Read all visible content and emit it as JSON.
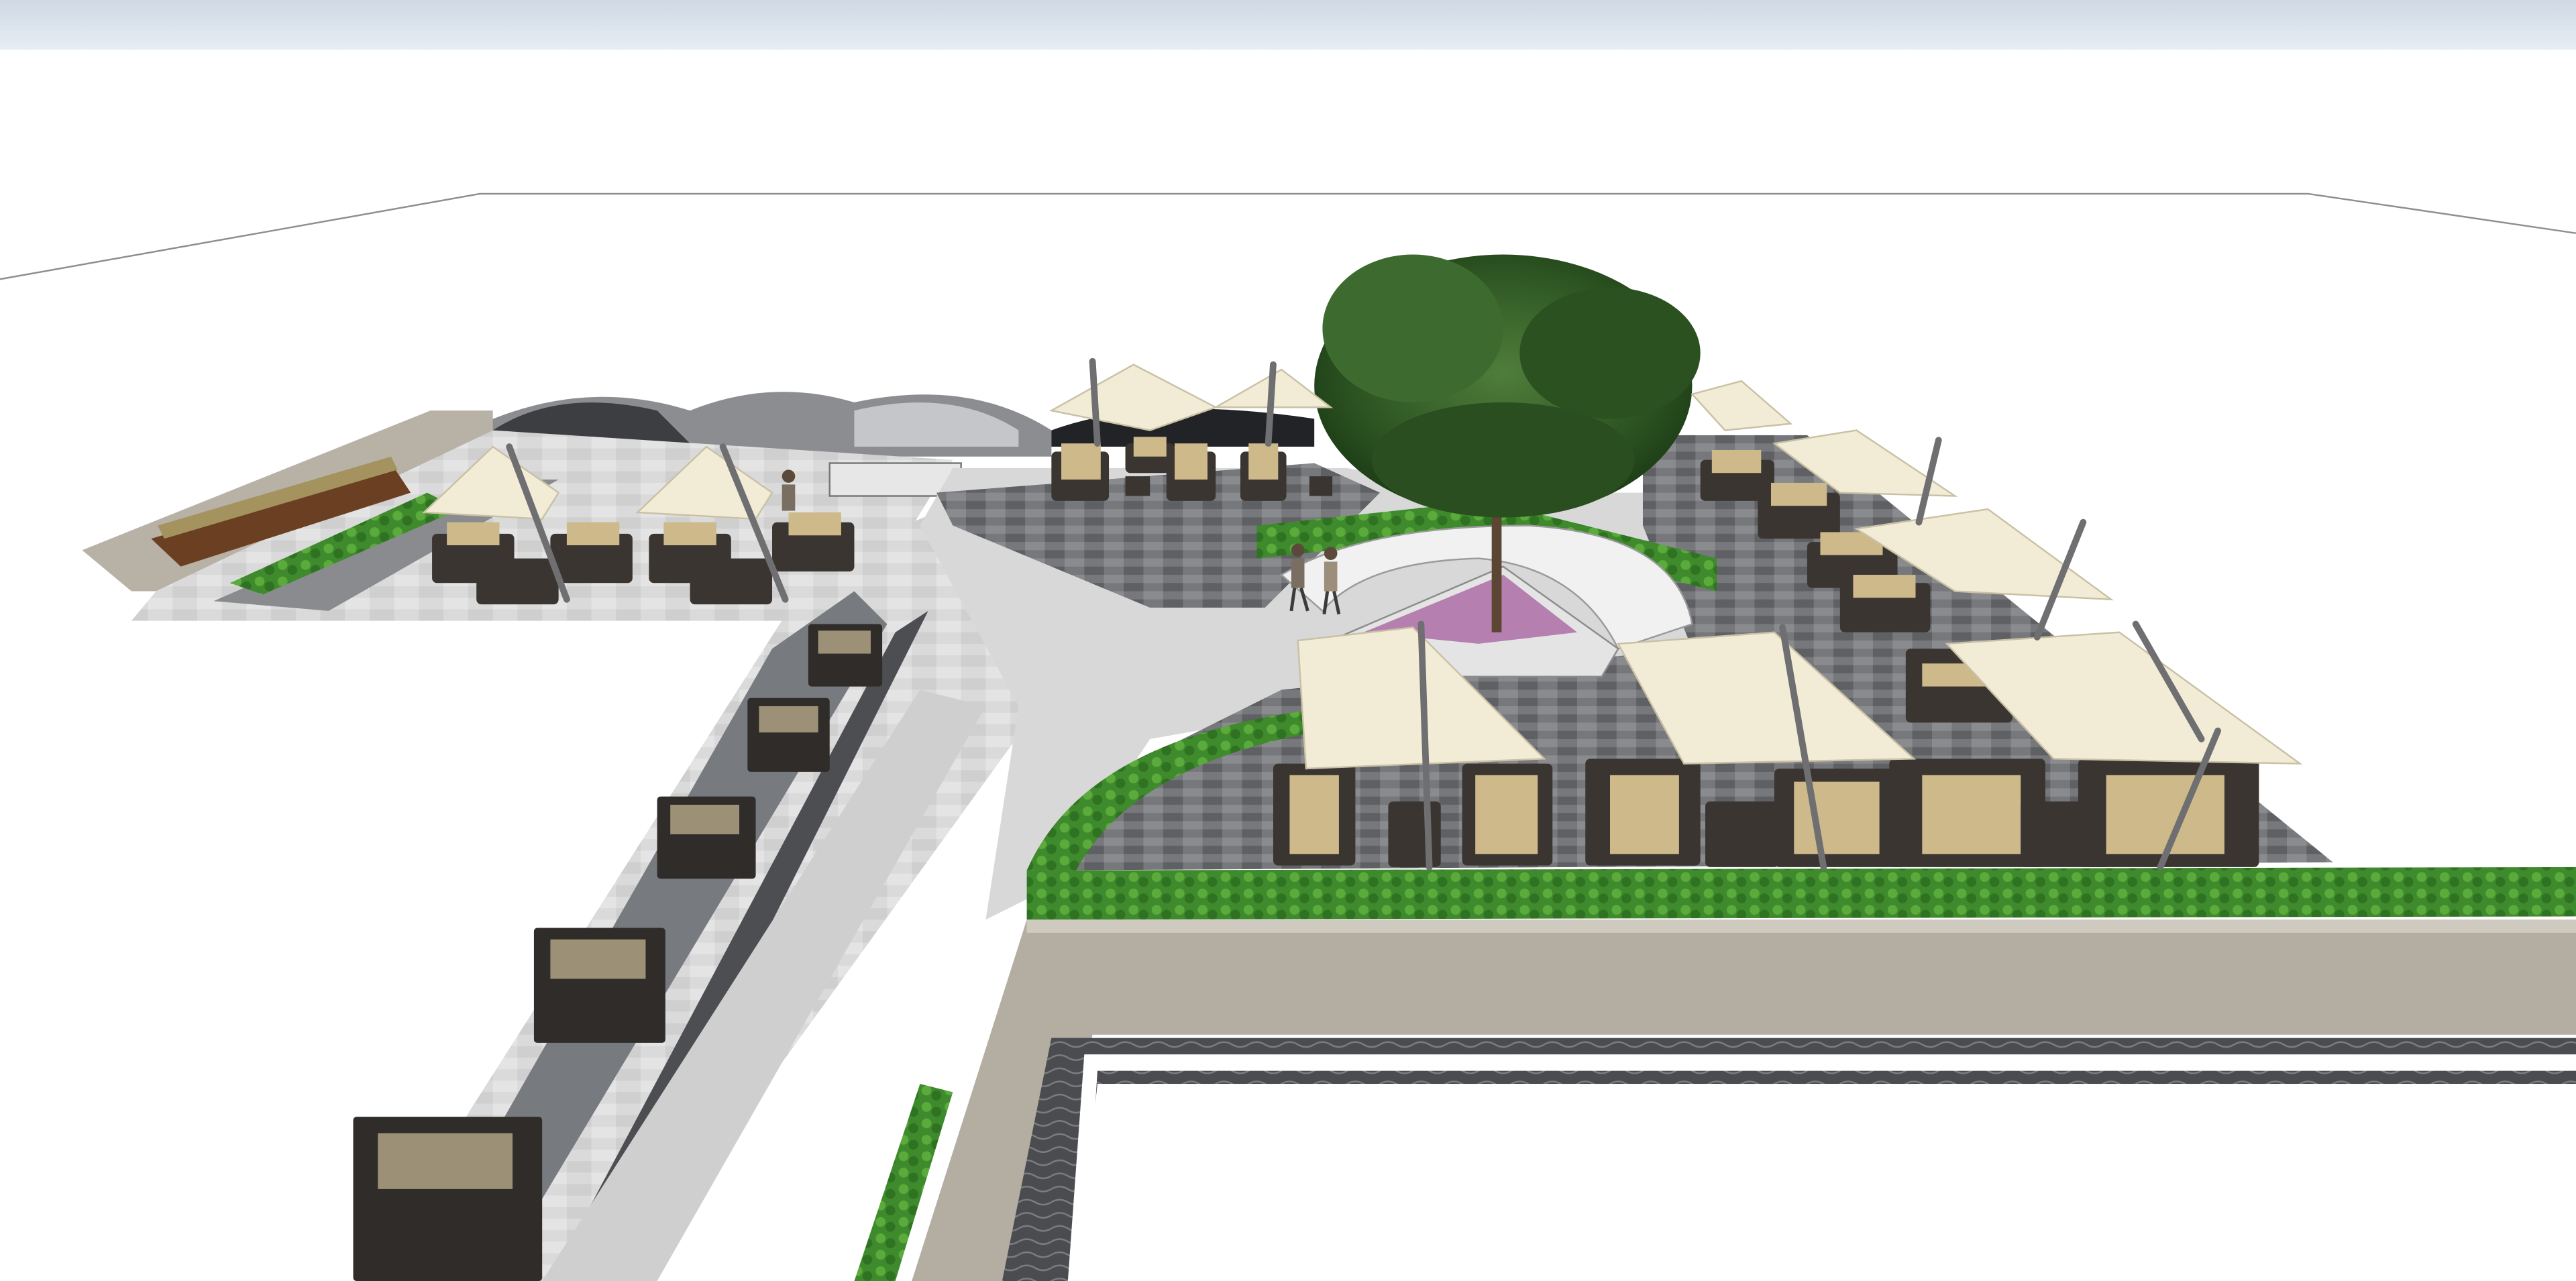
{
  "viewport": {
    "kind": "3d-model-view",
    "sky_colors": [
      "#cfd9e4",
      "#e6edf4"
    ],
    "ground_color": "#ffffff"
  },
  "scene": {
    "elements": [
      "rooftop-terrace",
      "shade-tree",
      "tensile-shade-sails",
      "lounge-sofas",
      "bistro-tables",
      "planter-hedges",
      "pedestrian-figures",
      "stone-paving",
      "flower-bed"
    ],
    "colors": {
      "paving_light": "#dcdcdc",
      "paving_dark": "#6d6e72",
      "hedge": "#3f8d2e",
      "sail": "#f2ecd6",
      "sofa_frame": "#3a3531",
      "sofa_cushion": "#cdb98a",
      "parapet": "#b4aea2",
      "tree": "#2f5a24",
      "flowers": "#b57fb0"
    }
  }
}
